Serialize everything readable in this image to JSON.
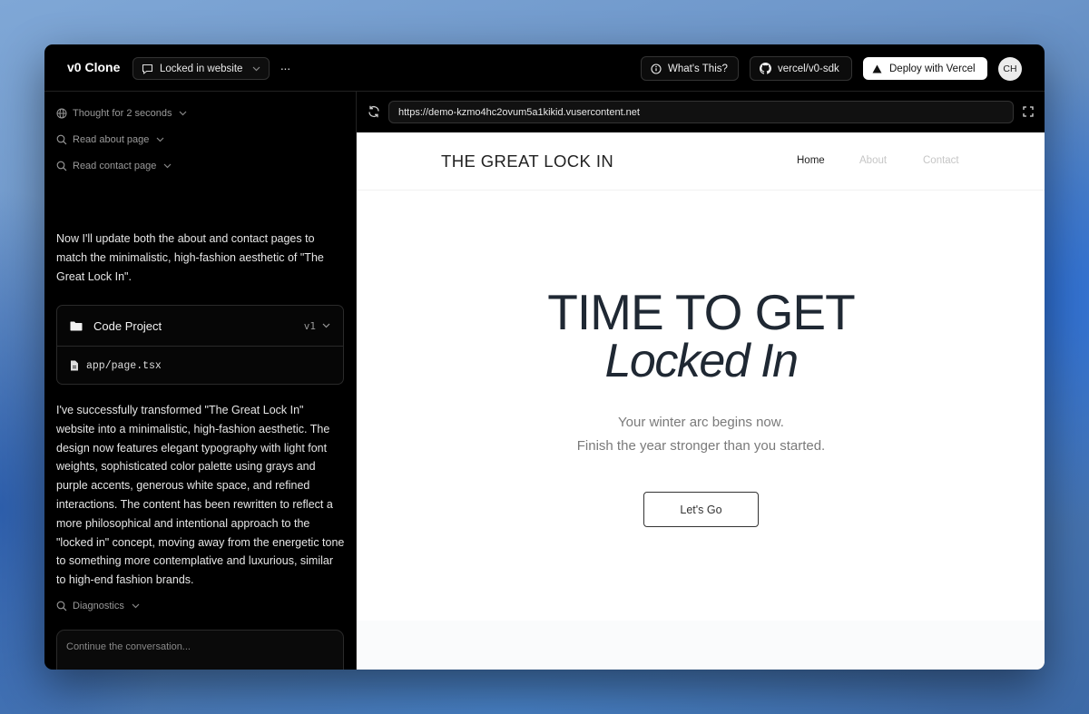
{
  "header": {
    "app_title": "v0 Clone",
    "chat_name": "Locked in website",
    "more": "···",
    "whats_this": "What's This?",
    "github": "vercel/v0-sdk",
    "deploy": "Deploy with Vercel",
    "avatar_initials": "CH"
  },
  "chat": {
    "steps": [
      {
        "label": "Thought for 2 seconds",
        "icon": "globe-icon"
      },
      {
        "label": "Read about page",
        "icon": "search-icon"
      },
      {
        "label": "Read contact page",
        "icon": "search-icon"
      }
    ],
    "message_1": "Now I'll update both the about and contact pages to match the minimalistic, high-fashion aesthetic of \"The Great Lock In\".",
    "project": {
      "name": "Code Project",
      "version": "v1",
      "file": "app/page.tsx"
    },
    "message_2": "I've successfully transformed \"The Great Lock In\" website into a minimalistic, high-fashion aesthetic. The design now features elegant typography with light font weights, sophisticated color palette using grays and purple accents, generous white space, and refined interactions. The content has been rewritten to reflect a more philosophical and intentional approach to the \"locked in\" concept, moving away from the energetic tone to something more contemplative and luxurious, similar to high-end fashion brands.",
    "diagnostics": "Diagnostics",
    "composer_placeholder": "Continue the conversation..."
  },
  "preview": {
    "url": "https://demo-kzmo4hc2ovum5a1kikid.vusercontent.net",
    "site": {
      "brand": "THE GREAT LOCK IN",
      "nav": [
        "Home",
        "About",
        "Contact"
      ],
      "headline_1": "TIME TO GET",
      "headline_2": "Locked In",
      "tagline_1": "Your winter arc begins now.",
      "tagline_2": "Finish the year stronger than you started.",
      "cta": "Let's Go"
    }
  },
  "colors": {
    "window_bg": "#000000",
    "site_bg": "#ffffff",
    "headline": "#1f2833",
    "muted_text": "#7a7a7a"
  }
}
